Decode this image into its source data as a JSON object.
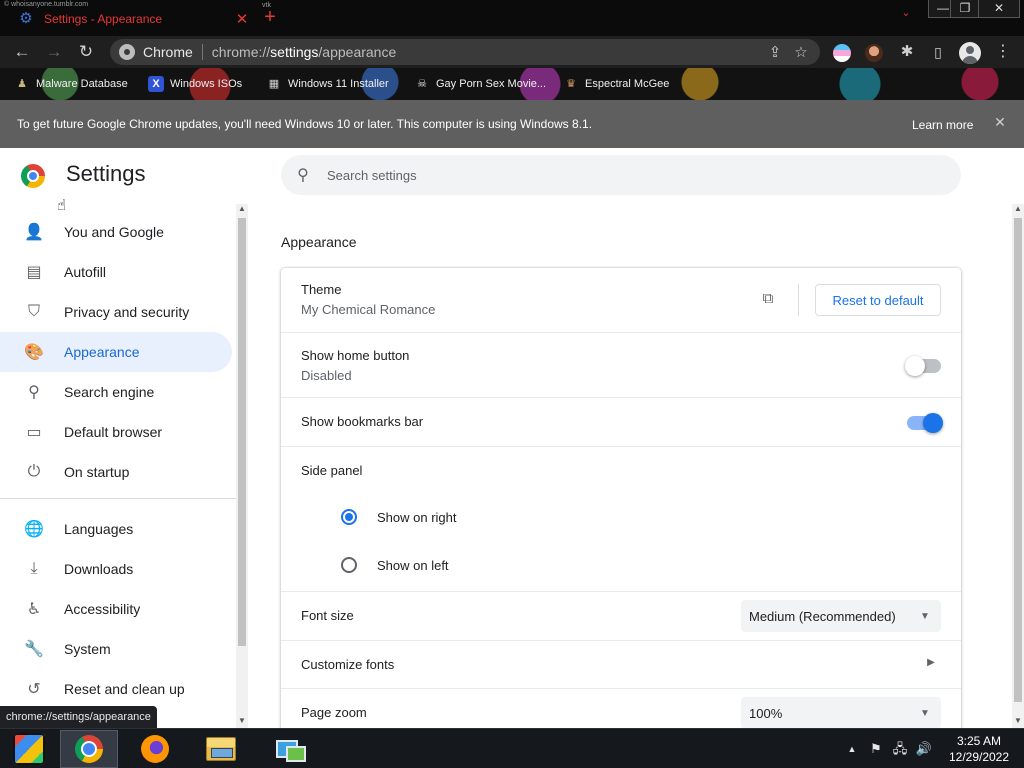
{
  "window": {
    "watermark": "© whoisanyone.tumblr.com",
    "watermark2": "vtk",
    "tab_title": "Settings - Appearance",
    "tab_close_glyph": "✕",
    "new_tab_glyph": "+",
    "tab_search_glyph": "⌄",
    "min_glyph": "—",
    "max_glyph": "❐",
    "close_glyph": "✕"
  },
  "toolbar": {
    "back_glyph": "←",
    "forward_glyph": "→",
    "reload_glyph": "↻",
    "site_name": "Chrome",
    "url_prefix": "chrome://",
    "url_host": "settings",
    "url_path": "/appearance",
    "share_glyph": "⇪",
    "star_glyph": "☆",
    "puzzle_glyph": "✱",
    "sidepanel_glyph": "▯",
    "menu_glyph": "⋮"
  },
  "bookmarks": [
    {
      "label": "Malware Database",
      "icon_glyph": "♟",
      "icon_color": "#c8b37a"
    },
    {
      "label": "Windows ISOs",
      "icon_glyph": "X",
      "icon_color": "#2f55d4"
    },
    {
      "label": "Windows 11 Installer",
      "icon_glyph": "▦",
      "icon_color": "#d0d0d0"
    },
    {
      "label": "Gay Porn Sex Movie...",
      "icon_glyph": "☠",
      "icon_color": "#e0e0e0"
    },
    {
      "label": "Espectral McGee",
      "icon_glyph": "♛",
      "icon_color": "#d89a6a"
    }
  ],
  "infobar": {
    "message": "To get future Google Chrome updates, you'll need Windows 10 or later. This computer is using Windows 8.1.",
    "link": "Learn more",
    "close_glyph": "✕"
  },
  "settings": {
    "title": "Settings",
    "search_placeholder": "Search settings",
    "search_glyph": "⚲",
    "nav": [
      {
        "label": "You and Google",
        "glyph": "👤"
      },
      {
        "label": "Autofill",
        "glyph": "▤"
      },
      {
        "label": "Privacy and security",
        "glyph": "⛉"
      },
      {
        "label": "Appearance",
        "glyph": "🎨"
      },
      {
        "label": "Search engine",
        "glyph": "⚲"
      },
      {
        "label": "Default browser",
        "glyph": "▭"
      },
      {
        "label": "On startup",
        "glyph": "⏻"
      },
      {
        "label": "Languages",
        "glyph": "🌐"
      },
      {
        "label": "Downloads",
        "glyph": "⤓"
      },
      {
        "label": "Accessibility",
        "glyph": "♿"
      },
      {
        "label": "System",
        "glyph": "🔧"
      },
      {
        "label": "Reset and clean up",
        "glyph": "↺"
      }
    ],
    "active_nav": "Appearance",
    "section_title": "Appearance",
    "theme": {
      "label": "Theme",
      "value": "My Chemical Romance",
      "reset_label": "Reset to default",
      "open_glyph": "⧉"
    },
    "home_button": {
      "label": "Show home button",
      "value": "Disabled",
      "enabled": false
    },
    "bookmarks_bar": {
      "label": "Show bookmarks bar",
      "enabled": true
    },
    "side_panel": {
      "label": "Side panel",
      "options": [
        "Show on right",
        "Show on left"
      ],
      "selected": "Show on right"
    },
    "font_size": {
      "label": "Font size",
      "value": "Medium (Recommended)",
      "caret_glyph": "▼"
    },
    "customize_fonts": {
      "label": "Customize fonts",
      "arrow_glyph": "▶"
    },
    "page_zoom": {
      "label": "Page zoom",
      "value": "100%",
      "caret_glyph": "▼"
    }
  },
  "status_url": "chrome://settings/appearance",
  "taskbar": {
    "tray_up_glyph": "▲",
    "tray_flag_glyph": "⚑",
    "tray_network_glyph": "🖧",
    "tray_volume_glyph": "🔊",
    "time": "3:25 AM",
    "date": "12/29/2022"
  },
  "colors": {
    "accent": "#1a73e8",
    "active_nav_bg": "#e8f0fe",
    "tab_title": "#e53935",
    "infobar_bg": "#5f5f5f"
  }
}
